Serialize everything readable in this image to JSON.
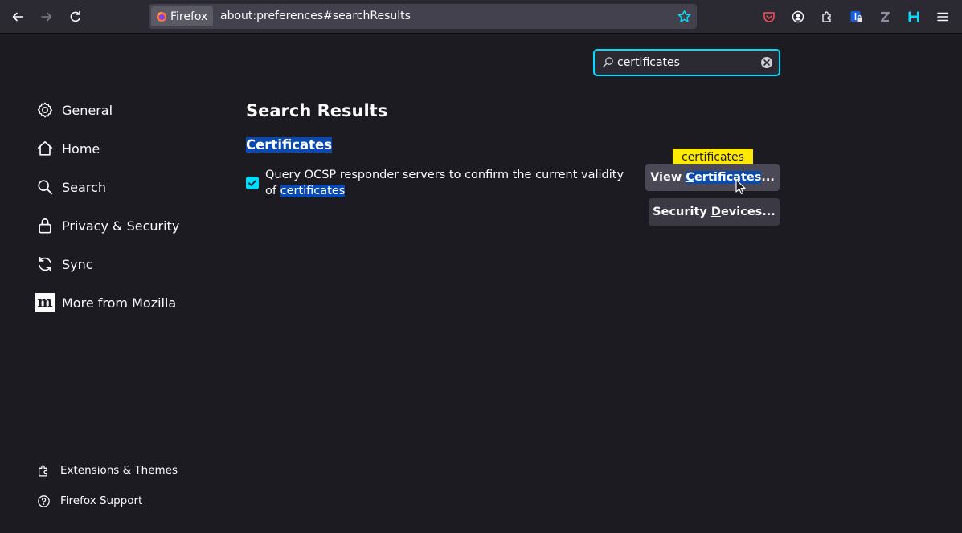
{
  "toolbar": {
    "back_icon": "arrow-left-icon",
    "forward_icon": "arrow-right-icon",
    "reload_icon": "reload-icon",
    "identity_label": "Firefox",
    "url": "about:preferences#searchResults",
    "bookmark_icon": "star-icon",
    "right_icons": [
      "pocket-icon",
      "account-icon",
      "extensions-icon",
      "bitwarden-icon",
      "zotero-icon",
      "save-icon",
      "menu-icon"
    ]
  },
  "search": {
    "value": "certificates",
    "placeholder": ""
  },
  "sidebar": {
    "items": [
      {
        "label": "General",
        "icon": "gear-icon"
      },
      {
        "label": "Home",
        "icon": "home-icon"
      },
      {
        "label": "Search",
        "icon": "search-icon"
      },
      {
        "label": "Privacy & Security",
        "icon": "lock-icon"
      },
      {
        "label": "Sync",
        "icon": "sync-icon"
      },
      {
        "label": "More from Mozilla",
        "icon": "mozilla-icon"
      }
    ],
    "footer": [
      {
        "label": "Extensions & Themes",
        "icon": "puzzle-icon"
      },
      {
        "label": "Firefox Support",
        "icon": "help-icon"
      }
    ]
  },
  "main": {
    "title": "Search Results",
    "section_title": "Certificates",
    "ocsp_label": "Query OCSP responder servers to confirm the current validity of",
    "ocsp_label_highlight": "certificates",
    "ocsp_checked": true,
    "view_button": {
      "prefix": "View ",
      "accesskey": "C",
      "highlighted": "ertificates",
      "suffix": "..."
    },
    "security_button": {
      "prefix": "Security ",
      "accesskey": "D",
      "rest": "evices..."
    },
    "tooltip": "certificates"
  },
  "colors": {
    "accent": "#00ddff",
    "highlight": "#0a4ab0",
    "tooltip": "#ffe900",
    "background": "#1c1b22"
  }
}
